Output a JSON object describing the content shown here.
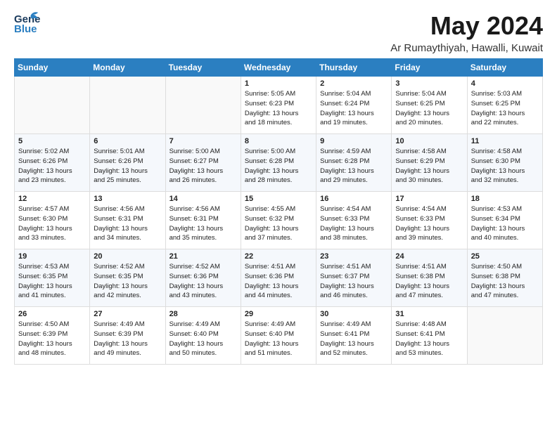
{
  "logo": {
    "line1": "General",
    "line2": "Blue"
  },
  "title": "May 2024",
  "subtitle": "Ar Rumaythiyah, Hawalli, Kuwait",
  "days_of_week": [
    "Sunday",
    "Monday",
    "Tuesday",
    "Wednesday",
    "Thursday",
    "Friday",
    "Saturday"
  ],
  "weeks": [
    [
      {
        "day": "",
        "info": ""
      },
      {
        "day": "",
        "info": ""
      },
      {
        "day": "",
        "info": ""
      },
      {
        "day": "1",
        "info": "Sunrise: 5:05 AM\nSunset: 6:23 PM\nDaylight: 13 hours\nand 18 minutes."
      },
      {
        "day": "2",
        "info": "Sunrise: 5:04 AM\nSunset: 6:24 PM\nDaylight: 13 hours\nand 19 minutes."
      },
      {
        "day": "3",
        "info": "Sunrise: 5:04 AM\nSunset: 6:25 PM\nDaylight: 13 hours\nand 20 minutes."
      },
      {
        "day": "4",
        "info": "Sunrise: 5:03 AM\nSunset: 6:25 PM\nDaylight: 13 hours\nand 22 minutes."
      }
    ],
    [
      {
        "day": "5",
        "info": "Sunrise: 5:02 AM\nSunset: 6:26 PM\nDaylight: 13 hours\nand 23 minutes."
      },
      {
        "day": "6",
        "info": "Sunrise: 5:01 AM\nSunset: 6:26 PM\nDaylight: 13 hours\nand 25 minutes."
      },
      {
        "day": "7",
        "info": "Sunrise: 5:00 AM\nSunset: 6:27 PM\nDaylight: 13 hours\nand 26 minutes."
      },
      {
        "day": "8",
        "info": "Sunrise: 5:00 AM\nSunset: 6:28 PM\nDaylight: 13 hours\nand 28 minutes."
      },
      {
        "day": "9",
        "info": "Sunrise: 4:59 AM\nSunset: 6:28 PM\nDaylight: 13 hours\nand 29 minutes."
      },
      {
        "day": "10",
        "info": "Sunrise: 4:58 AM\nSunset: 6:29 PM\nDaylight: 13 hours\nand 30 minutes."
      },
      {
        "day": "11",
        "info": "Sunrise: 4:58 AM\nSunset: 6:30 PM\nDaylight: 13 hours\nand 32 minutes."
      }
    ],
    [
      {
        "day": "12",
        "info": "Sunrise: 4:57 AM\nSunset: 6:30 PM\nDaylight: 13 hours\nand 33 minutes."
      },
      {
        "day": "13",
        "info": "Sunrise: 4:56 AM\nSunset: 6:31 PM\nDaylight: 13 hours\nand 34 minutes."
      },
      {
        "day": "14",
        "info": "Sunrise: 4:56 AM\nSunset: 6:31 PM\nDaylight: 13 hours\nand 35 minutes."
      },
      {
        "day": "15",
        "info": "Sunrise: 4:55 AM\nSunset: 6:32 PM\nDaylight: 13 hours\nand 37 minutes."
      },
      {
        "day": "16",
        "info": "Sunrise: 4:54 AM\nSunset: 6:33 PM\nDaylight: 13 hours\nand 38 minutes."
      },
      {
        "day": "17",
        "info": "Sunrise: 4:54 AM\nSunset: 6:33 PM\nDaylight: 13 hours\nand 39 minutes."
      },
      {
        "day": "18",
        "info": "Sunrise: 4:53 AM\nSunset: 6:34 PM\nDaylight: 13 hours\nand 40 minutes."
      }
    ],
    [
      {
        "day": "19",
        "info": "Sunrise: 4:53 AM\nSunset: 6:35 PM\nDaylight: 13 hours\nand 41 minutes."
      },
      {
        "day": "20",
        "info": "Sunrise: 4:52 AM\nSunset: 6:35 PM\nDaylight: 13 hours\nand 42 minutes."
      },
      {
        "day": "21",
        "info": "Sunrise: 4:52 AM\nSunset: 6:36 PM\nDaylight: 13 hours\nand 43 minutes."
      },
      {
        "day": "22",
        "info": "Sunrise: 4:51 AM\nSunset: 6:36 PM\nDaylight: 13 hours\nand 44 minutes."
      },
      {
        "day": "23",
        "info": "Sunrise: 4:51 AM\nSunset: 6:37 PM\nDaylight: 13 hours\nand 46 minutes."
      },
      {
        "day": "24",
        "info": "Sunrise: 4:51 AM\nSunset: 6:38 PM\nDaylight: 13 hours\nand 47 minutes."
      },
      {
        "day": "25",
        "info": "Sunrise: 4:50 AM\nSunset: 6:38 PM\nDaylight: 13 hours\nand 47 minutes."
      }
    ],
    [
      {
        "day": "26",
        "info": "Sunrise: 4:50 AM\nSunset: 6:39 PM\nDaylight: 13 hours\nand 48 minutes."
      },
      {
        "day": "27",
        "info": "Sunrise: 4:49 AM\nSunset: 6:39 PM\nDaylight: 13 hours\nand 49 minutes."
      },
      {
        "day": "28",
        "info": "Sunrise: 4:49 AM\nSunset: 6:40 PM\nDaylight: 13 hours\nand 50 minutes."
      },
      {
        "day": "29",
        "info": "Sunrise: 4:49 AM\nSunset: 6:40 PM\nDaylight: 13 hours\nand 51 minutes."
      },
      {
        "day": "30",
        "info": "Sunrise: 4:49 AM\nSunset: 6:41 PM\nDaylight: 13 hours\nand 52 minutes."
      },
      {
        "day": "31",
        "info": "Sunrise: 4:48 AM\nSunset: 6:41 PM\nDaylight: 13 hours\nand 53 minutes."
      },
      {
        "day": "",
        "info": ""
      }
    ]
  ]
}
